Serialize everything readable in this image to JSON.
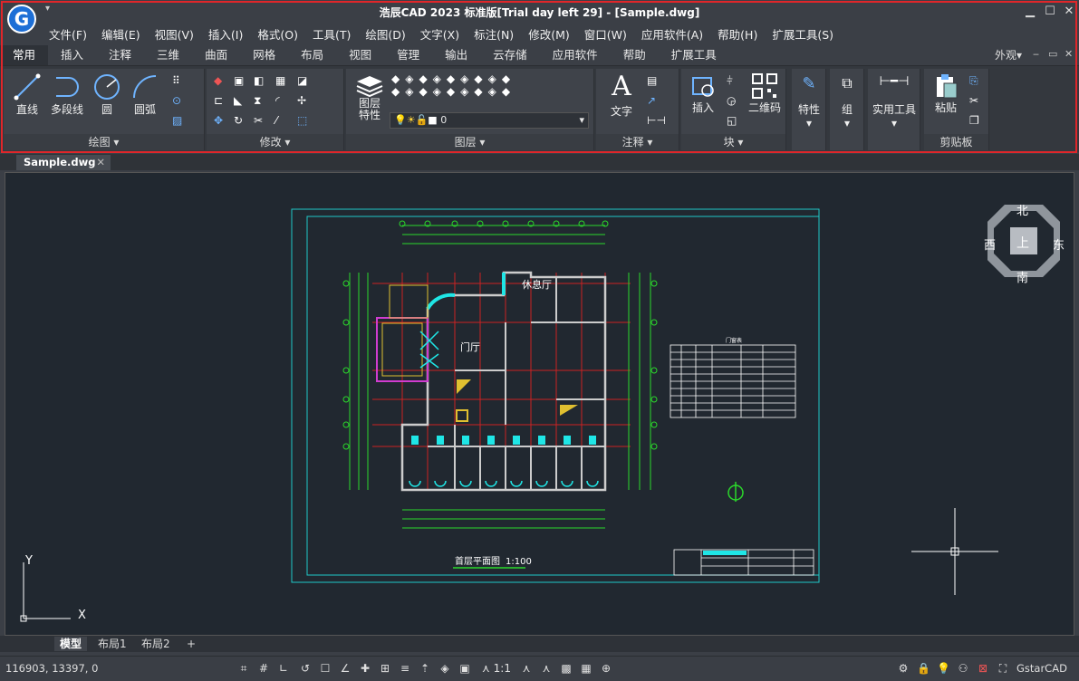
{
  "app": {
    "title": "浩辰CAD 2023 标准版[Trial day left 29] - [Sample.dwg]",
    "logo_letter": "G",
    "qat_symbol": "▾"
  },
  "window": {
    "minimize": "▁",
    "maximize": "☐",
    "close": "✕"
  },
  "menubar": [
    "文件(F)",
    "编辑(E)",
    "视图(V)",
    "插入(I)",
    "格式(O)",
    "工具(T)",
    "绘图(D)",
    "文字(X)",
    "标注(N)",
    "修改(M)",
    "窗口(W)",
    "应用软件(A)",
    "帮助(H)",
    "扩展工具(S)"
  ],
  "ribbon_tabs": [
    "常用",
    "插入",
    "注释",
    "三维",
    "曲面",
    "网格",
    "布局",
    "视图",
    "管理",
    "输出",
    "云存储",
    "应用软件",
    "帮助",
    "扩展工具"
  ],
  "ribbon_right": {
    "appearance": "外观",
    "min": "‒",
    "restore": "▭",
    "close": "✕"
  },
  "panels": {
    "draw": {
      "title": "绘图",
      "tools": [
        "直线",
        "多段线",
        "圆",
        "圆弧"
      ]
    },
    "modify": {
      "title": "修改"
    },
    "layers": {
      "title": "图层",
      "tool": "图层\n特性",
      "current_layer": "0"
    },
    "annotation": {
      "title": "注释",
      "tool": "文字"
    },
    "block": {
      "title": "块",
      "tools": [
        "插入",
        "二维码"
      ]
    },
    "properties": {
      "tool": "特性"
    },
    "group": {
      "tool": "组"
    },
    "utilities": {
      "tool": "实用工具"
    },
    "clipboard": {
      "title": "剪贴板",
      "tool": "粘贴"
    }
  },
  "document": {
    "tab": "Sample.dwg",
    "close": "✕"
  },
  "drawing": {
    "room1": "休息厅",
    "room2": "门厅",
    "caption": "首层平面图",
    "scale": "1:100",
    "table_title": "门窗表"
  },
  "viewcube": {
    "north": "北",
    "south": "南",
    "east": "东",
    "west": "西",
    "top": "上"
  },
  "ucs": {
    "x": "X",
    "y": "Y"
  },
  "layouts": [
    "模型",
    "布局1",
    "布局2",
    "+"
  ],
  "status": {
    "coords": "116903, 13397, 0",
    "brand": "GstarCAD",
    "scale": "1:1"
  }
}
